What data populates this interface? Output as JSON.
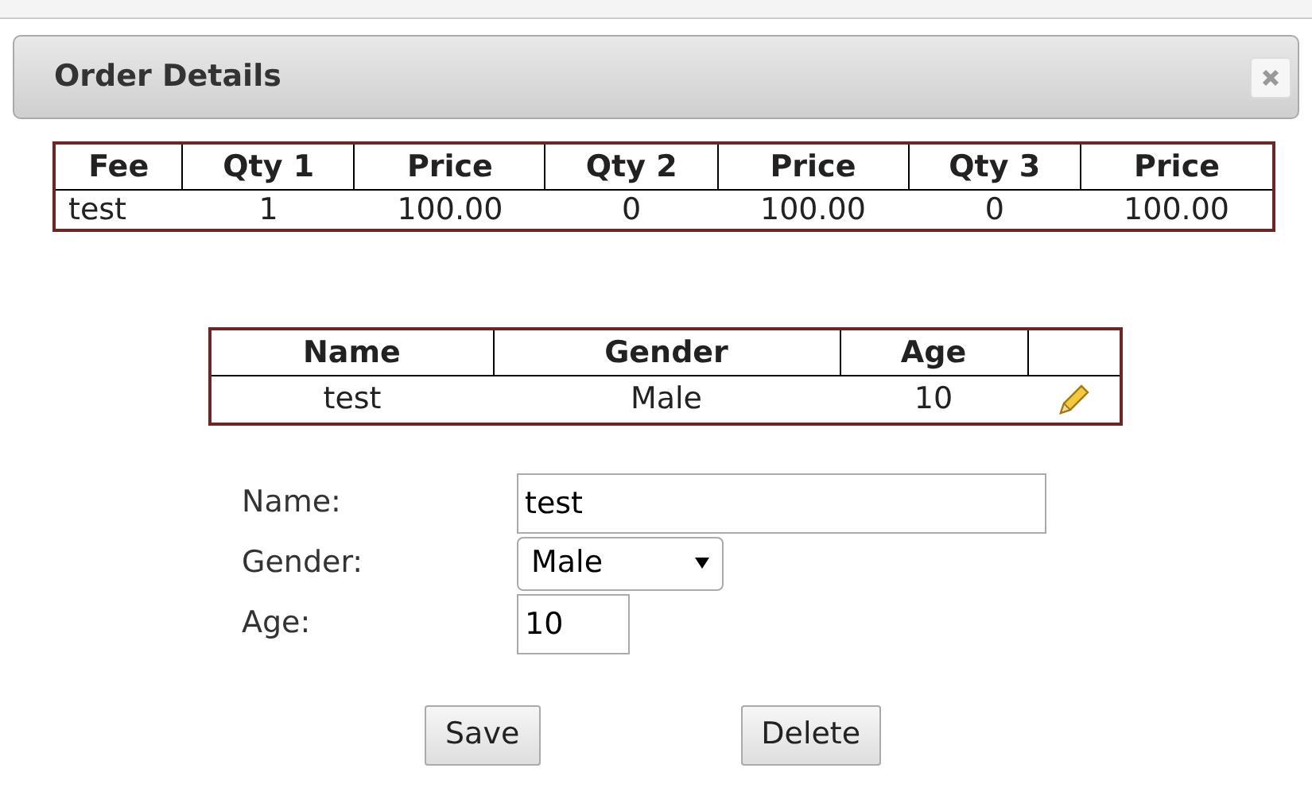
{
  "dialog": {
    "title": "Order Details"
  },
  "fees_table": {
    "columns": [
      "Fee",
      "Qty 1",
      "Price",
      "Qty 2",
      "Price",
      "Qty 3",
      "Price"
    ],
    "rows": [
      [
        "test",
        "1",
        "100.00",
        "0",
        "100.00",
        "0",
        "100.00"
      ]
    ]
  },
  "people_table": {
    "columns": [
      "Name",
      "Gender",
      "Age"
    ],
    "rows": [
      [
        "test",
        "Male",
        "10"
      ]
    ]
  },
  "form": {
    "fields": [
      {
        "label": "Name:",
        "kind": "text",
        "value": "test"
      },
      {
        "label": "Gender:",
        "kind": "select",
        "value": "Male"
      },
      {
        "label": "Age:",
        "kind": "number",
        "value": "10"
      }
    ]
  },
  "buttons": [
    "Save",
    "Delete"
  ]
}
